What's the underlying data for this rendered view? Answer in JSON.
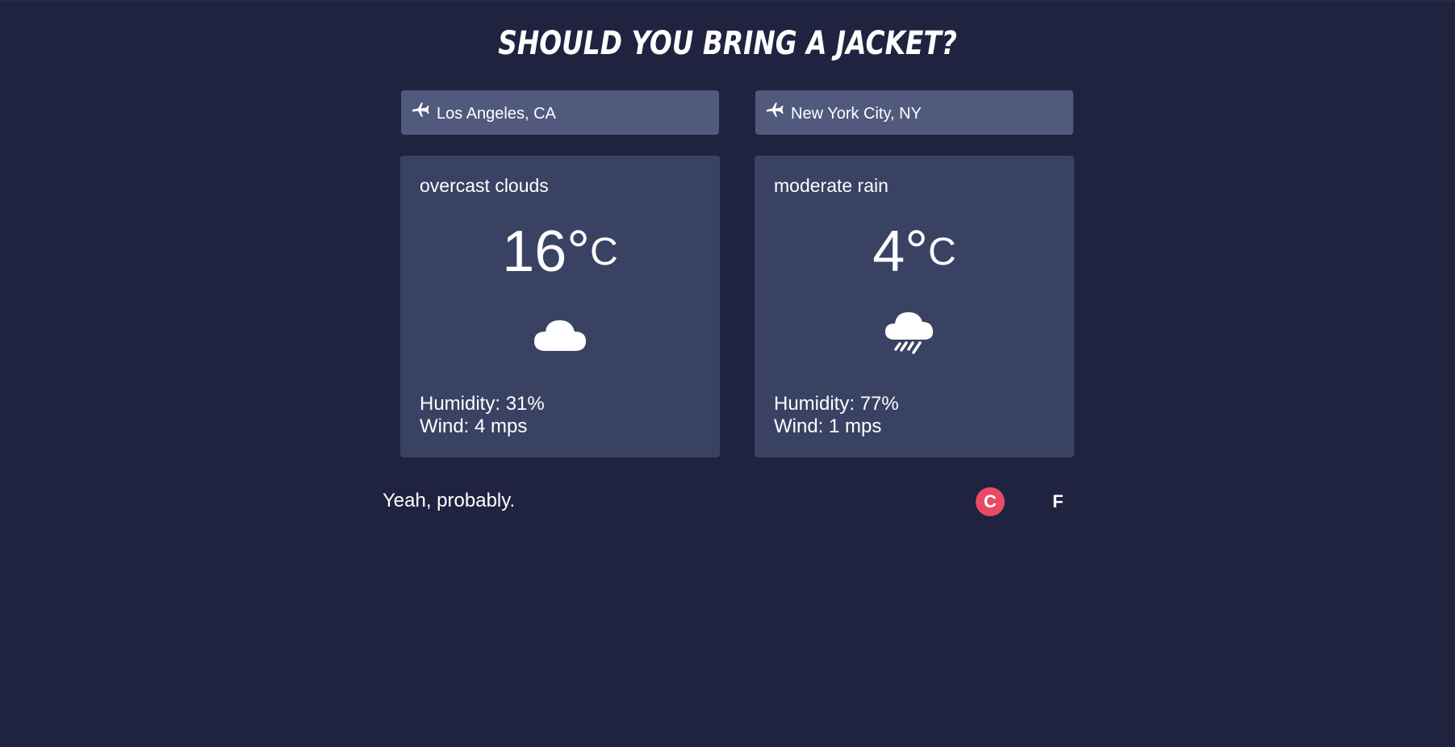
{
  "title": "Should you bring a jacket?",
  "locations": [
    {
      "city": "Los Angeles, CA",
      "icon": "airplane-icon",
      "description": "overcast clouds",
      "temperature": "16°",
      "temp_unit": "C",
      "weather_icon": "cloud-icon",
      "humidity": "Humidity: 31%",
      "wind": "Wind: 4 mps"
    },
    {
      "city": "New York City, NY",
      "icon": "airplane-icon",
      "description": "moderate rain",
      "temperature": "4°",
      "temp_unit": "C",
      "weather_icon": "rain-cloud-icon",
      "humidity": "Humidity: 77%",
      "wind": "Wind: 1 mps"
    }
  ],
  "verdict": "Yeah, probably.",
  "unit_toggle": {
    "celsius": "C",
    "fahrenheit": "F",
    "selected": "C"
  },
  "colors": {
    "background": "#1f2340",
    "input_bg": "#515a7d",
    "card_bg": "#3a4264",
    "accent": "#e84a66"
  }
}
